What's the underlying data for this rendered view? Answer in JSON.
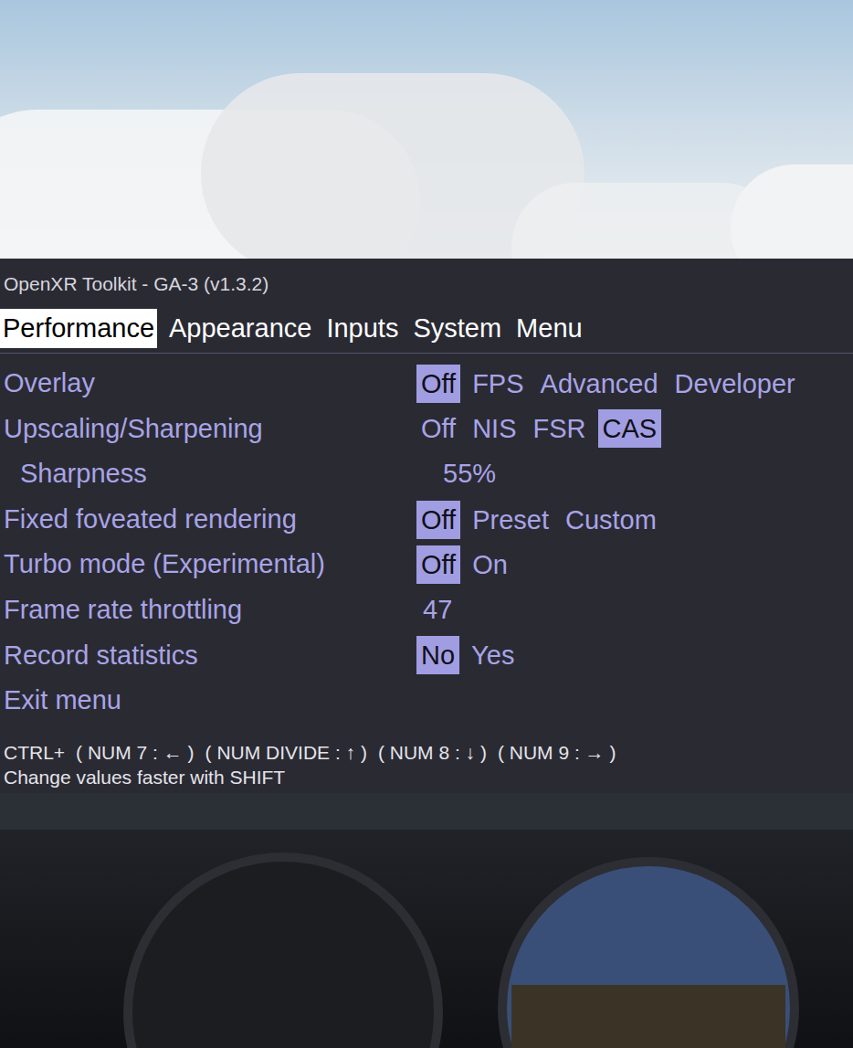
{
  "title": "OpenXR Toolkit - GA-3 (v1.3.2)",
  "tabs": [
    {
      "label": "Performance",
      "selected": true
    },
    {
      "label": "Appearance",
      "selected": false
    },
    {
      "label": "Inputs",
      "selected": false
    },
    {
      "label": "System",
      "selected": false
    },
    {
      "label": "Menu",
      "selected": false
    }
  ],
  "rows": [
    {
      "kind": "options",
      "label": "Overlay",
      "options": [
        {
          "label": "Off",
          "selected": true
        },
        {
          "label": "FPS",
          "selected": false
        },
        {
          "label": "Advanced",
          "selected": false
        },
        {
          "label": "Developer",
          "selected": false
        }
      ]
    },
    {
      "kind": "options",
      "label": "Upscaling/Sharpening",
      "options": [
        {
          "label": "Off",
          "selected": false
        },
        {
          "label": "NIS",
          "selected": false
        },
        {
          "label": "FSR",
          "selected": false
        },
        {
          "label": "CAS",
          "selected": true
        }
      ]
    },
    {
      "kind": "subvalue",
      "label": "Sharpness",
      "value": "55%"
    },
    {
      "kind": "options",
      "label": "Fixed foveated rendering",
      "options": [
        {
          "label": "Off",
          "selected": true
        },
        {
          "label": "Preset",
          "selected": false
        },
        {
          "label": "Custom",
          "selected": false
        }
      ]
    },
    {
      "kind": "options",
      "label": "Turbo mode (Experimental)",
      "options": [
        {
          "label": "Off",
          "selected": true
        },
        {
          "label": "On",
          "selected": false
        }
      ]
    },
    {
      "kind": "value",
      "label": "Frame rate throttling",
      "value": "47"
    },
    {
      "kind": "options",
      "label": "Record statistics",
      "options": [
        {
          "label": "No",
          "selected": true
        },
        {
          "label": "Yes",
          "selected": false
        }
      ]
    },
    {
      "kind": "action",
      "label": "Exit menu"
    }
  ],
  "footer": {
    "keys": [
      "CTRL+",
      "( NUM 7 : ← )",
      "( NUM DIVIDE : ↑ )",
      "( NUM 8 : ↓ )",
      "( NUM 9 : → )"
    ],
    "hint": "Change values faster with SHIFT"
  }
}
